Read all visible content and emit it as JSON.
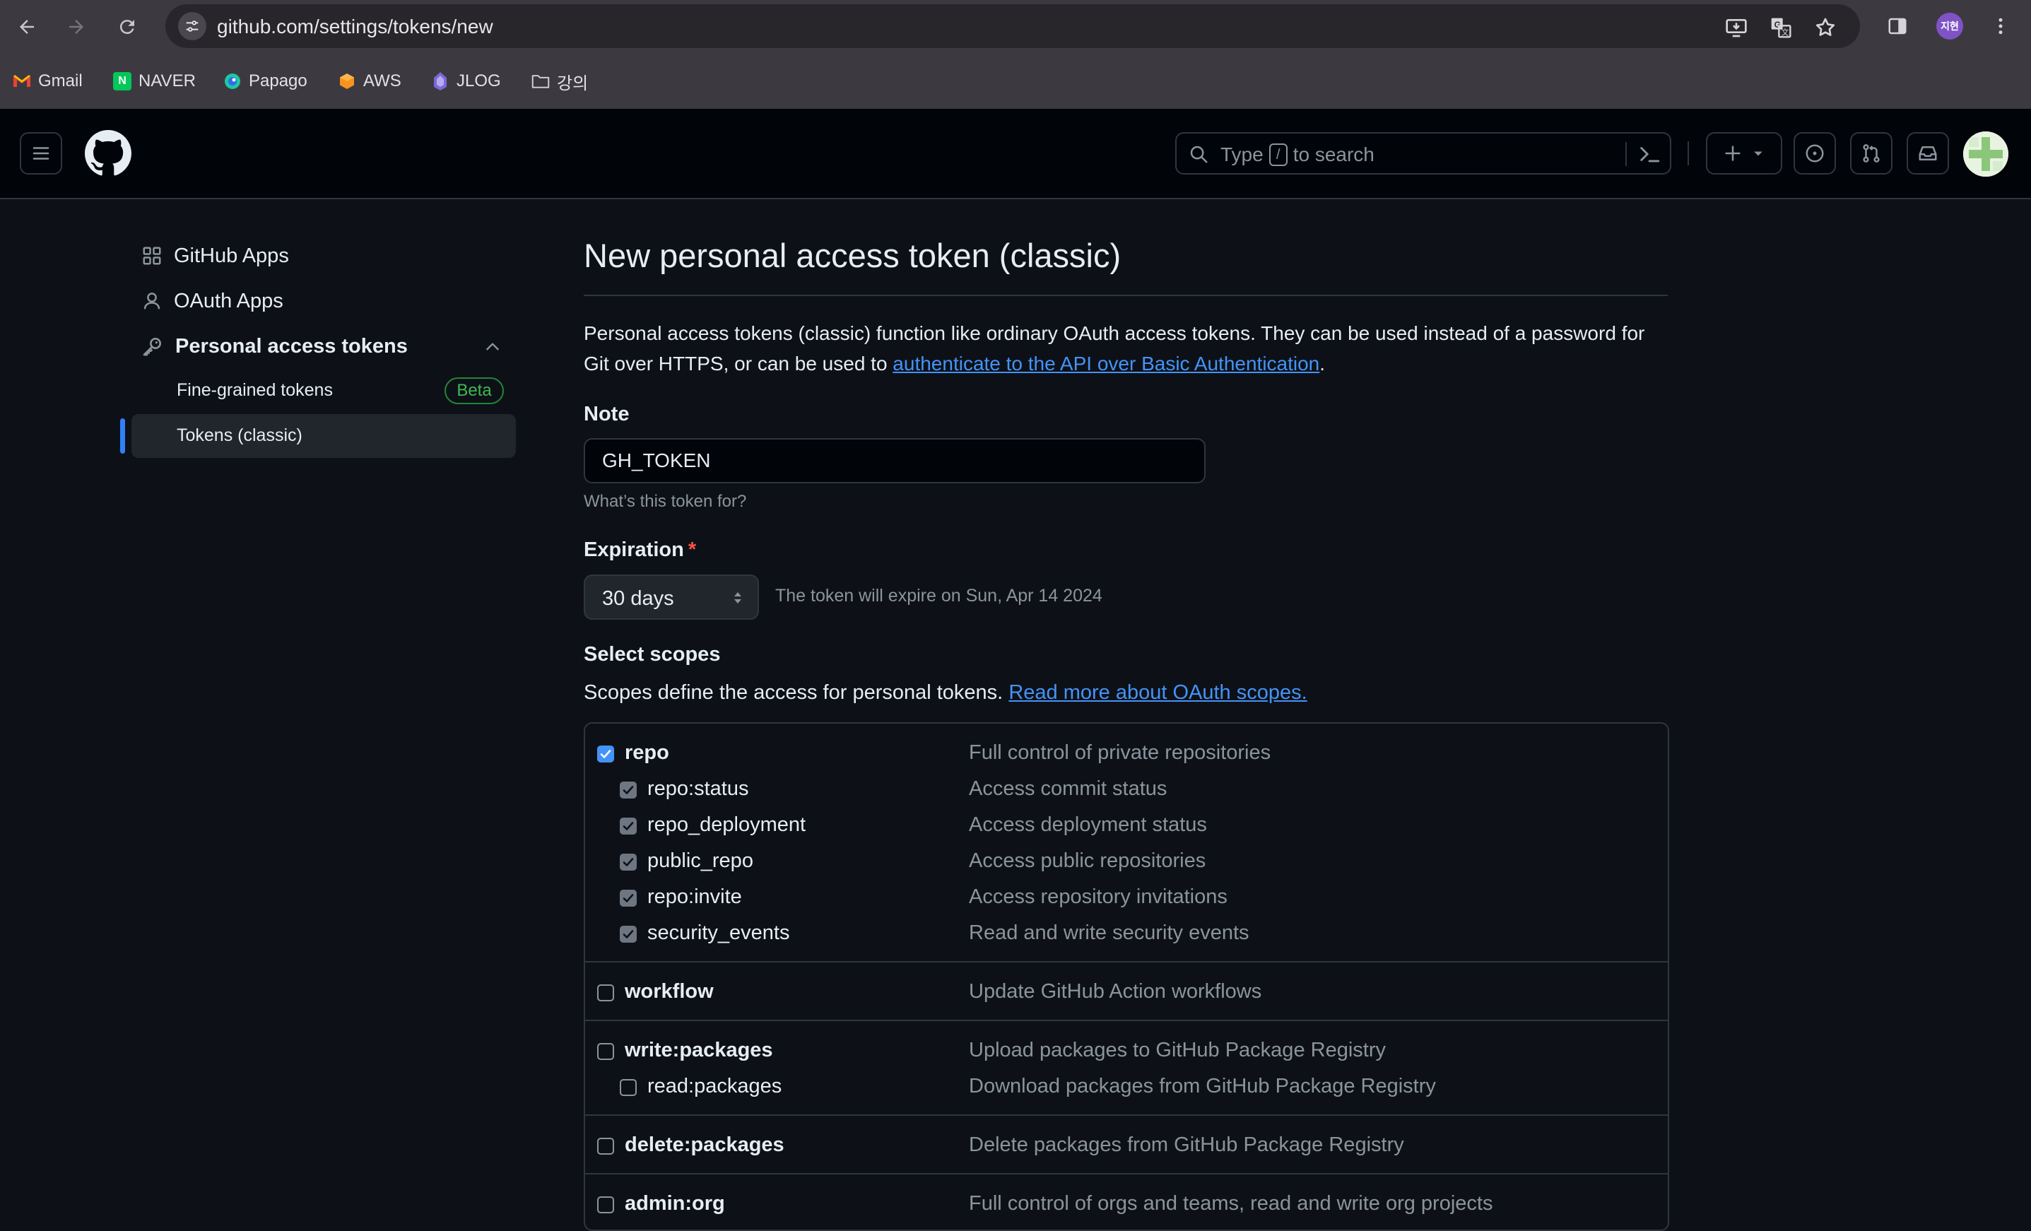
{
  "browser": {
    "url": "github.com/settings/tokens/new",
    "profile_initials": "지현",
    "bookmarks": [
      "Gmail",
      "NAVER",
      "Papago",
      "AWS",
      "JLOG",
      "강의"
    ]
  },
  "header": {
    "search_prefix": "Type",
    "search_key": "/",
    "search_suffix": "to search"
  },
  "sidebar": {
    "items": [
      {
        "label": "GitHub Apps"
      },
      {
        "label": "OAuth Apps"
      },
      {
        "label": "Personal access tokens"
      }
    ],
    "sub_items": [
      {
        "label": "Fine-grained tokens",
        "badge": "Beta"
      },
      {
        "label": "Tokens (classic)"
      }
    ]
  },
  "main": {
    "title": "New personal access token (classic)",
    "intro_text": "Personal access tokens (classic) function like ordinary OAuth access tokens. They can be used instead of a password for Git over HTTPS, or can be used to",
    "intro_link": "authenticate to the API over Basic Authentication",
    "note_label": "Note",
    "note_value": "GH_TOKEN",
    "note_hint": "What’s this token for?",
    "expiration_label": "Expiration",
    "expiration_required": "*",
    "expiration_value": "30 days",
    "expiration_note": "The token will expire on Sun, Apr 14 2024",
    "scopes_label": "Select scopes",
    "scopes_text": "Scopes define the access for personal tokens.",
    "scopes_link": "Read more about OAuth scopes.",
    "scopes": [
      {
        "name": "repo",
        "desc": "Full control of private repositories",
        "checked": true
      },
      {
        "name": "repo:status",
        "desc": "Access commit status",
        "checked": true
      },
      {
        "name": "repo_deployment",
        "desc": "Access deployment status",
        "checked": true
      },
      {
        "name": "public_repo",
        "desc": "Access public repositories",
        "checked": true
      },
      {
        "name": "repo:invite",
        "desc": "Access repository invitations",
        "checked": true
      },
      {
        "name": "security_events",
        "desc": "Read and write security events",
        "checked": true
      },
      {
        "name": "workflow",
        "desc": "Update GitHub Action workflows",
        "checked": false
      },
      {
        "name": "write:packages",
        "desc": "Upload packages to GitHub Package Registry",
        "checked": false
      },
      {
        "name": "read:packages",
        "desc": "Download packages from GitHub Package Registry",
        "checked": false
      },
      {
        "name": "delete:packages",
        "desc": "Delete packages from GitHub Package Registry",
        "checked": false
      },
      {
        "name": "admin:org",
        "desc": "Full control of orgs and teams, read and write org projects",
        "checked": false
      }
    ]
  },
  "colors": {
    "background": "#0d1117",
    "header_bg": "#010409",
    "link": "#4493f8",
    "success": "#3fb950",
    "danger": "#f85149",
    "active_indicator": "#2f81f7"
  }
}
